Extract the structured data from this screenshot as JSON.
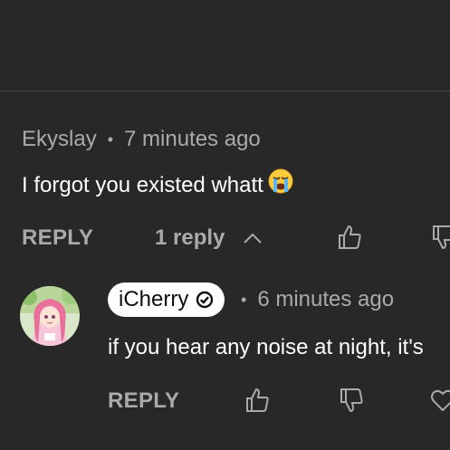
{
  "colors": {
    "background": "#282828",
    "secondary_text": "#aaaaaa",
    "primary_text": "#ffffff",
    "divider": "#4a4a4a"
  },
  "comment": {
    "author": "Ekyslay",
    "time": "7 minutes ago",
    "text": "I forgot you existed whatt",
    "emoji": "loudly-crying-face",
    "reply_label": "REPLY",
    "replies_label": "1 reply",
    "replies_icon": "chevron-up-icon",
    "like_icon": "thumbs-up-icon",
    "dislike_icon": "thumbs-down-icon"
  },
  "reply": {
    "author": "iCherry",
    "verified_icon": "verified-check-icon",
    "time": "6 minutes ago",
    "text": "if you hear any noise at night, it's",
    "reply_label": "REPLY",
    "like_icon": "thumbs-up-icon",
    "dislike_icon": "thumbs-down-icon",
    "heart_icon": "heart-icon"
  }
}
